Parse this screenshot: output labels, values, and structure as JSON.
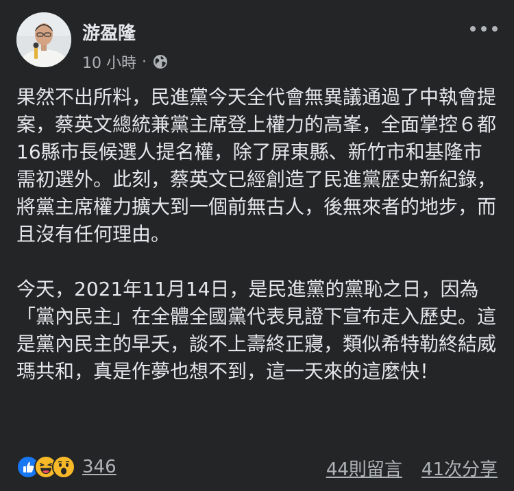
{
  "post": {
    "author": "游盈隆",
    "time": "10 小時",
    "separator": "·",
    "paragraphs": [
      "果然不出所料，民進黨今天全代會無異議通過了中執會提案，蔡英文總統兼黨主席登上權力的高峯，全面掌控６都16縣市長候選人提名權，除了屏東縣、新竹市和基隆市需初選外。此刻，蔡英文已經創造了民進黨歷史新紀錄，將黨主席權力擴大到一個前無古人，後無來者的地步，而且沒有任何理由。",
      "今天，2021年11月14日，是民進黨的黨恥之日，因為「黨內民主」在全體全國黨代表見證下宣布走入歷史。這是黨內民主的早夭，談不上壽終正寢，類似希特勒終結威瑪共和，真是作夢也想不到，這一天來的這麼快！"
    ]
  },
  "footer": {
    "reaction_count": "346",
    "comments": "44則留言",
    "shares": "41次分享",
    "reactions": [
      "like-icon",
      "haha-icon",
      "wow-icon"
    ]
  },
  "colors": {
    "background": "#242526",
    "text": "#e4e6eb",
    "secondary": "#b0b3b8",
    "like": "#1877f2",
    "emoji": "#f7b928"
  }
}
